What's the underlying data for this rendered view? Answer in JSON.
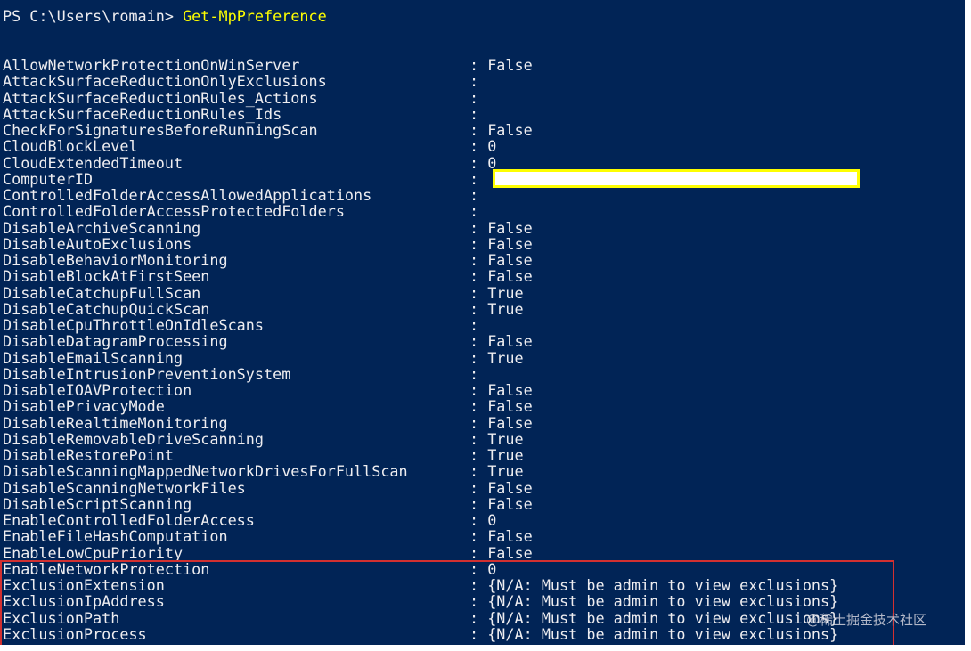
{
  "prompt": {
    "path": "PS C:\\Users\\romain> ",
    "command": "Get-MpPreference"
  },
  "rows": [
    {
      "name": "AllowNetworkProtectionOnWinServer",
      "value": ": False"
    },
    {
      "name": "AttackSurfaceReductionOnlyExclusions",
      "value": ":"
    },
    {
      "name": "AttackSurfaceReductionRules_Actions",
      "value": ":"
    },
    {
      "name": "AttackSurfaceReductionRules_Ids",
      "value": ":"
    },
    {
      "name": "CheckForSignaturesBeforeRunningScan",
      "value": ": False"
    },
    {
      "name": "CloudBlockLevel",
      "value": ": 0"
    },
    {
      "name": "CloudExtendedTimeout",
      "value": ": 0"
    },
    {
      "name": "ComputerID",
      "value": ":"
    },
    {
      "name": "ControlledFolderAccessAllowedApplications",
      "value": ":"
    },
    {
      "name": "ControlledFolderAccessProtectedFolders",
      "value": ":"
    },
    {
      "name": "DisableArchiveScanning",
      "value": ": False"
    },
    {
      "name": "DisableAutoExclusions",
      "value": ": False"
    },
    {
      "name": "DisableBehaviorMonitoring",
      "value": ": False"
    },
    {
      "name": "DisableBlockAtFirstSeen",
      "value": ": False"
    },
    {
      "name": "DisableCatchupFullScan",
      "value": ": True"
    },
    {
      "name": "DisableCatchupQuickScan",
      "value": ": True"
    },
    {
      "name": "DisableCpuThrottleOnIdleScans",
      "value": ":"
    },
    {
      "name": "DisableDatagramProcessing",
      "value": ": False"
    },
    {
      "name": "DisableEmailScanning",
      "value": ": True"
    },
    {
      "name": "DisableIntrusionPreventionSystem",
      "value": ":"
    },
    {
      "name": "DisableIOAVProtection",
      "value": ": False"
    },
    {
      "name": "DisablePrivacyMode",
      "value": ": False"
    },
    {
      "name": "DisableRealtimeMonitoring",
      "value": ": False"
    },
    {
      "name": "DisableRemovableDriveScanning",
      "value": ": True"
    },
    {
      "name": "DisableRestorePoint",
      "value": ": True"
    },
    {
      "name": "DisableScanningMappedNetworkDrivesForFullScan",
      "value": ": True"
    },
    {
      "name": "DisableScanningNetworkFiles",
      "value": ": False"
    },
    {
      "name": "DisableScriptScanning",
      "value": ": False"
    },
    {
      "name": "EnableControlledFolderAccess",
      "value": ": 0"
    },
    {
      "name": "EnableFileHashComputation",
      "value": ": False"
    },
    {
      "name": "EnableLowCpuPriority",
      "value": ": False"
    },
    {
      "name": "EnableNetworkProtection",
      "value": ": 0"
    },
    {
      "name": "ExclusionExtension",
      "value": ": {N/A: Must be admin to view exclusions}"
    },
    {
      "name": "ExclusionIpAddress",
      "value": ": {N/A: Must be admin to view exclusions}"
    },
    {
      "name": "ExclusionPath",
      "value": ": {N/A: Must be admin to view exclusions}"
    },
    {
      "name": "ExclusionProcess",
      "value": ": {N/A: Must be admin to view exclusions}"
    }
  ],
  "watermark": "@稀土掘金技术社区",
  "colors": {
    "background": "#012456",
    "text": "#eeedf0",
    "command": "#fefe00",
    "redaction_border": "#fefe00",
    "highlight_border": "#d23030"
  }
}
